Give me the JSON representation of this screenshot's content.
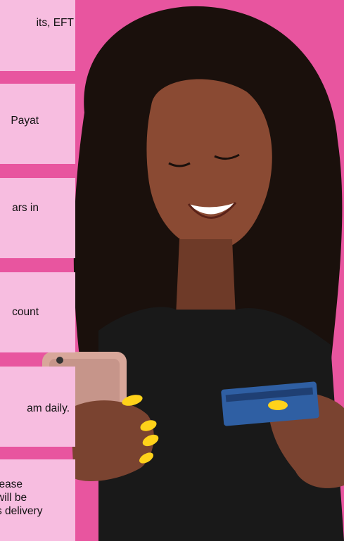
{
  "cards": [
    {
      "text": "its, EFT"
    },
    {
      "text": "Payat"
    },
    {
      "text": "ars in"
    },
    {
      "text": "count"
    },
    {
      "text": "am daily."
    },
    {
      "lines": [
        "lease",
        "will be",
        "s delivery"
      ]
    }
  ],
  "colors": {
    "background": "#e8559f",
    "card": "#f7bde0",
    "nails": "#ffd21a",
    "shirt": "#191919",
    "skin": "#7a4330",
    "hair": "#1a100c",
    "card_blue": "#2f5fa3"
  }
}
